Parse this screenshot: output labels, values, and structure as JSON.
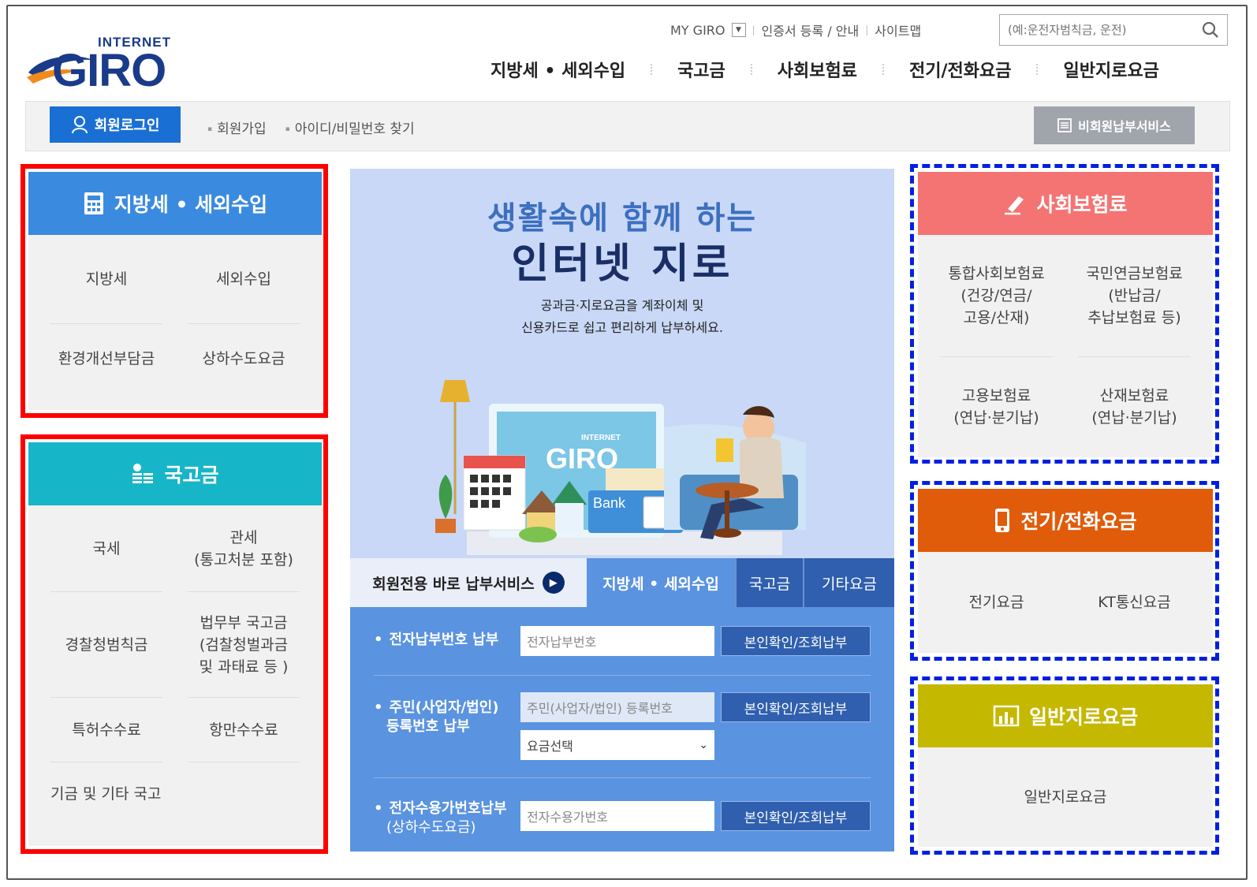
{
  "header": {
    "logo_top": "INTERNET",
    "logo_main": "GIRO",
    "util": [
      "MY GIRO",
      "인증서 등록 / 안내",
      "사이트맵"
    ],
    "search_placeholder": "(예:운전자범칙금, 운전)",
    "gnb": [
      "지방세 • 세외수입",
      "국고금",
      "사회보험료",
      "전기/전화요금",
      "일반지로요금"
    ]
  },
  "loginbar": {
    "login": "회원로그인",
    "links": [
      "회원가입",
      "아이디/비밀번호 찾기"
    ],
    "guest": "비회원납부서비스"
  },
  "left": {
    "local": {
      "title": "지방세 • 세외수입",
      "items": [
        "지방세",
        "세외수입",
        "환경개선부담금",
        "상하수도요금"
      ]
    },
    "national": {
      "title": "국고금",
      "items": [
        "국세",
        "관세\n(통고처분 포함)",
        "경찰청범칙금",
        "법무부 국고금\n(검찰청벌과금\n및 과태료 등 )",
        "특허수수료",
        "항만수수료",
        "기금 및 기타 국고"
      ]
    }
  },
  "center": {
    "title1": "생활속에 함께 하는",
    "title2": "인터넷 지로",
    "sub1": "공과금·지로요금을 계좌이체 및",
    "sub2": "신용카드로 쉽고 편리하게 납부하세요.",
    "illu_logo": "GIRO",
    "illu_logo_top": "INTERNET",
    "illu_bank": "Bank",
    "tabs": [
      "회원전용 바로 납부서비스",
      "지방세 • 세외수입",
      "국고금",
      "기타요금"
    ],
    "rows": [
      {
        "label": "전자납부번호 납부",
        "placeholder": "전자납부번호",
        "button": "본인확인/조회납부"
      },
      {
        "label1": "주민(사업자/법인)",
        "label2": "등록번호 납부",
        "placeholder": "주민(사업자/법인) 등록번호",
        "select": "요금선택",
        "button": "본인확인/조회납부"
      },
      {
        "label1": "전자수용가번호납부",
        "label2": "(상하수도요금)",
        "placeholder": "전자수용가번호",
        "button": "본인확인/조회납부"
      }
    ]
  },
  "right": {
    "social": {
      "title": "사회보험료",
      "items": [
        "통합사회보험료\n(건강/연금/\n고용/산재)",
        "국민연금보험료\n(반납금/\n추납보험료 등)",
        "고용보험료\n(연납·분기납)",
        "산재보험료\n(연납·분기납)"
      ]
    },
    "elec": {
      "title": "전기/전화요금",
      "items": [
        "전기요금",
        "KT통신요금"
      ]
    },
    "general": {
      "title": "일반지로요금",
      "items": [
        "일반지로요금"
      ]
    }
  },
  "colors": {
    "local": "#3a8be0",
    "national": "#17b5c8",
    "social": "#f47474",
    "elec": "#e05b0a",
    "general": "#c5b800",
    "annot_red": "#ff0000",
    "annot_blue": "#0020e0"
  }
}
